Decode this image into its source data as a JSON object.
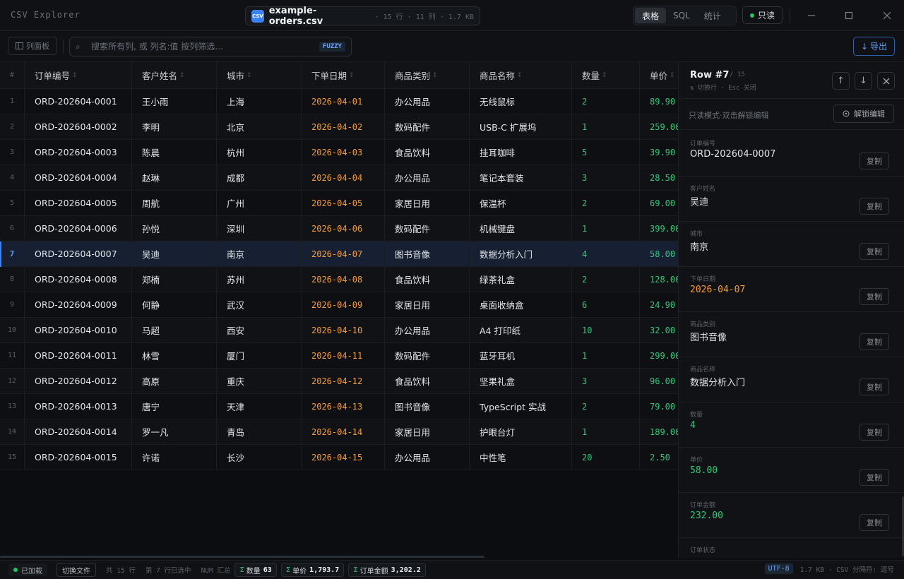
{
  "app": {
    "title": "CSV Explorer",
    "file_badge": "CSV",
    "file_name": "example-orders.csv",
    "file_meta": "· 15 行 · 11 列 · 1.7 KB",
    "view_tabs": [
      "表格",
      "SQL",
      "统计"
    ],
    "active_tab": "表格",
    "readonly_label": "只读"
  },
  "toolbar": {
    "column_panel_label": "列面板",
    "search_placeholder": "搜索所有列, 或 列名:值 按列筛选…",
    "fuzzy_label": "FUZZY",
    "export_label": "导出"
  },
  "table": {
    "columns": [
      "#",
      "订单编号",
      "客户姓名",
      "城市",
      "下单日期",
      "商品类别",
      "商品名称",
      "数量",
      "单价"
    ],
    "selected_index": 7,
    "rows": [
      [
        "1",
        "ORD-202604-0001",
        "王小雨",
        "上海",
        "2026-04-01",
        "办公用品",
        "无线鼠标",
        "2",
        "89.90"
      ],
      [
        "2",
        "ORD-202604-0002",
        "李明",
        "北京",
        "2026-04-02",
        "数码配件",
        "USB-C 扩展坞",
        "1",
        "259.00"
      ],
      [
        "3",
        "ORD-202604-0003",
        "陈晨",
        "杭州",
        "2026-04-03",
        "食品饮料",
        "挂耳咖啡",
        "5",
        "39.90"
      ],
      [
        "4",
        "ORD-202604-0004",
        "赵琳",
        "成都",
        "2026-04-04",
        "办公用品",
        "笔记本套装",
        "3",
        "28.50"
      ],
      [
        "5",
        "ORD-202604-0005",
        "周航",
        "广州",
        "2026-04-05",
        "家居日用",
        "保温杯",
        "2",
        "69.00"
      ],
      [
        "6",
        "ORD-202604-0006",
        "孙悦",
        "深圳",
        "2026-04-06",
        "数码配件",
        "机械键盘",
        "1",
        "399.00"
      ],
      [
        "7",
        "ORD-202604-0007",
        "吴迪",
        "南京",
        "2026-04-07",
        "图书音像",
        "数据分析入门",
        "4",
        "58.00"
      ],
      [
        "8",
        "ORD-202604-0008",
        "郑楠",
        "苏州",
        "2026-04-08",
        "食品饮料",
        "绿茶礼盒",
        "2",
        "128.00"
      ],
      [
        "9",
        "ORD-202604-0009",
        "何静",
        "武汉",
        "2026-04-09",
        "家居日用",
        "桌面收纳盒",
        "6",
        "24.90"
      ],
      [
        "10",
        "ORD-202604-0010",
        "马超",
        "西安",
        "2026-04-10",
        "办公用品",
        "A4 打印纸",
        "10",
        "32.00"
      ],
      [
        "11",
        "ORD-202604-0011",
        "林雪",
        "厦门",
        "2026-04-11",
        "数码配件",
        "蓝牙耳机",
        "1",
        "299.00"
      ],
      [
        "12",
        "ORD-202604-0012",
        "高原",
        "重庆",
        "2026-04-12",
        "食品饮料",
        "坚果礼盒",
        "3",
        "96.00"
      ],
      [
        "13",
        "ORD-202604-0013",
        "唐宁",
        "天津",
        "2026-04-13",
        "图书音像",
        "TypeScript 实战",
        "2",
        "79.00"
      ],
      [
        "14",
        "ORD-202604-0014",
        "罗一凡",
        "青岛",
        "2026-04-14",
        "家居日用",
        "护眼台灯",
        "1",
        "189.00"
      ],
      [
        "15",
        "ORD-202604-0015",
        "许诺",
        "长沙",
        "2026-04-15",
        "办公用品",
        "中性笔",
        "20",
        "2.50"
      ]
    ]
  },
  "detail": {
    "row_label": "Row #7",
    "row_total": "/ 15",
    "row_hint": "⇅ 切换行 · Esc 关闭",
    "mode_text": "只读模式·双击解锁编辑",
    "unlock_label": "解锁编辑",
    "copy_label": "复制",
    "fields": [
      {
        "label": "订单编号",
        "value": "ORD-202604-0007",
        "kind": "text"
      },
      {
        "label": "客户姓名",
        "value": "吴迪",
        "kind": "text"
      },
      {
        "label": "城市",
        "value": "南京",
        "kind": "text"
      },
      {
        "label": "下单日期",
        "value": "2026-04-07",
        "kind": "date"
      },
      {
        "label": "商品类别",
        "value": "图书音像",
        "kind": "text"
      },
      {
        "label": "商品名称",
        "value": "数据分析入门",
        "kind": "text"
      },
      {
        "label": "数量",
        "value": "4",
        "kind": "num"
      },
      {
        "label": "单价",
        "value": "58.00",
        "kind": "num"
      },
      {
        "label": "订单金额",
        "value": "232.00",
        "kind": "num"
      },
      {
        "label": "订单状态",
        "value": "",
        "kind": "text"
      }
    ]
  },
  "status": {
    "loaded": "已加载",
    "switch_file": "切换文件",
    "total": "共 15 行",
    "selected": "第 7 行已选中",
    "num_sum": "NUM 汇总",
    "sums": [
      {
        "label": "数量",
        "value": "63"
      },
      {
        "label": "单价",
        "value": "1,793.7"
      },
      {
        "label": "订单金额",
        "value": "3,202.2"
      }
    ],
    "sigma": "Σ",
    "encoding": "UTF-8",
    "right_meta": "1.7 KB · CSV  分隔符: 逗号"
  },
  "colors": {
    "accent": "#3b82f6",
    "date": "#f59e3b",
    "number": "#34c77b",
    "background": "#0b0d10"
  }
}
